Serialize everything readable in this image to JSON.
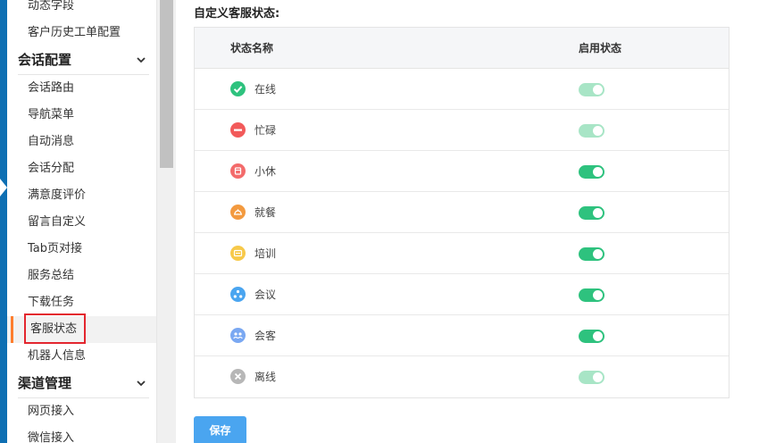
{
  "sidebar": {
    "items": [
      {
        "label": "动态字段"
      },
      {
        "label": "客户历史工单配置"
      }
    ],
    "group_session": {
      "label": "会话配置"
    },
    "session_items": [
      {
        "label": "会话路由"
      },
      {
        "label": "导航菜单"
      },
      {
        "label": "自动消息"
      },
      {
        "label": "会话分配"
      },
      {
        "label": "满意度评价"
      },
      {
        "label": "留言自定义"
      },
      {
        "label": "Tab页对接"
      },
      {
        "label": "服务总结"
      },
      {
        "label": "下载任务"
      },
      {
        "label": "客服状态"
      },
      {
        "label": "机器人信息"
      }
    ],
    "group_channel": {
      "label": "渠道管理"
    },
    "channel_items": [
      {
        "label": "网页接入"
      },
      {
        "label": "微信接入"
      }
    ]
  },
  "main": {
    "title": "自定义客服状态:",
    "table": {
      "col_name": "状态名称",
      "col_enabled": "启用状态",
      "rows": [
        {
          "name": "在线",
          "icon": "check-icon",
          "color": "#2ec27e",
          "enabled": true,
          "locked": true
        },
        {
          "name": "忙碌",
          "icon": "minus-icon",
          "color": "#f25a5a",
          "enabled": true,
          "locked": true
        },
        {
          "name": "小休",
          "icon": "cup-icon",
          "color": "#f36b6b",
          "enabled": true,
          "locked": false
        },
        {
          "name": "就餐",
          "icon": "dish-icon",
          "color": "#f39a3f",
          "enabled": true,
          "locked": false
        },
        {
          "name": "培训",
          "icon": "training-icon",
          "color": "#f7c94a",
          "enabled": true,
          "locked": false
        },
        {
          "name": "会议",
          "icon": "meeting-icon",
          "color": "#4aa5f0",
          "enabled": true,
          "locked": false
        },
        {
          "name": "会客",
          "icon": "guest-icon",
          "color": "#7aa8f2",
          "enabled": true,
          "locked": false
        },
        {
          "name": "离线",
          "icon": "close-icon",
          "color": "#b7b7b7",
          "enabled": true,
          "locked": true
        }
      ]
    },
    "save_label": "保存"
  },
  "colors": {
    "active_accent": "#ff7e2e",
    "highlight_box": "#e3262e",
    "toggle_on": "#2ec27e",
    "toggle_locked": "#a8e5c6",
    "primary_button": "#4aa5f0"
  }
}
